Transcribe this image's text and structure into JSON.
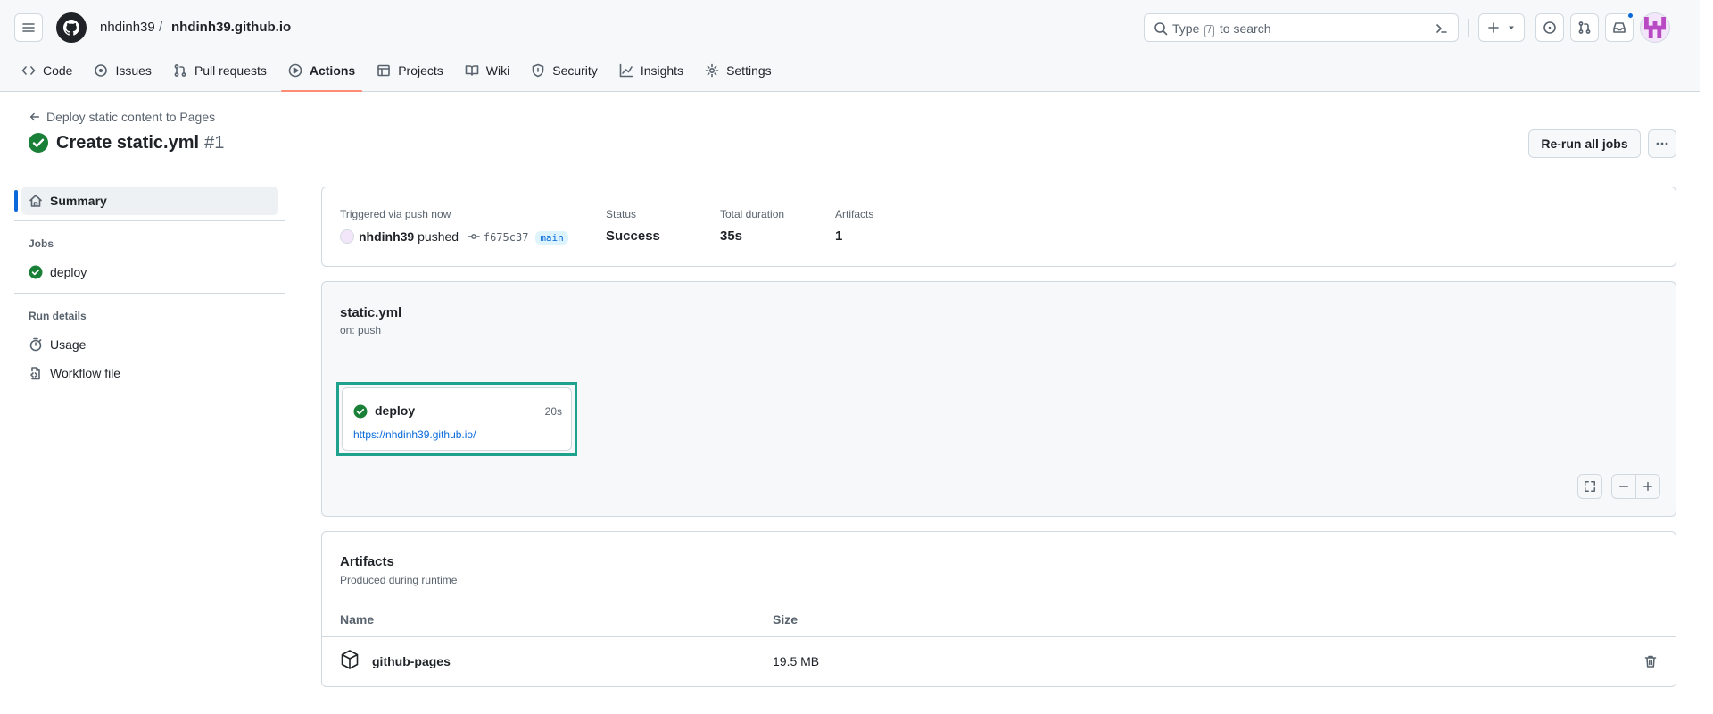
{
  "header": {
    "owner": "nhdinh39",
    "separator": "/",
    "repo": "nhdinh39.github.io",
    "search": {
      "pre": "Type",
      "key": "/",
      "post": "to search"
    }
  },
  "nav": {
    "tabs": [
      {
        "label": "Code",
        "icon": "code-icon"
      },
      {
        "label": "Issues",
        "icon": "issue-icon"
      },
      {
        "label": "Pull requests",
        "icon": "pull-request-icon"
      },
      {
        "label": "Actions",
        "icon": "play-icon",
        "active": true
      },
      {
        "label": "Projects",
        "icon": "table-icon"
      },
      {
        "label": "Wiki",
        "icon": "book-icon"
      },
      {
        "label": "Security",
        "icon": "shield-icon"
      },
      {
        "label": "Insights",
        "icon": "graph-icon"
      },
      {
        "label": "Settings",
        "icon": "gear-icon"
      }
    ]
  },
  "run": {
    "back_label": "Deploy static content to Pages",
    "title": "Create static.yml",
    "number": "#1",
    "rerun_label": "Re-run all jobs"
  },
  "sidebar": {
    "summary": "Summary",
    "jobs_heading": "Jobs",
    "job": "deploy",
    "run_details_heading": "Run details",
    "usage": "Usage",
    "workflow_file": "Workflow file"
  },
  "summary": {
    "trigger_label": "Triggered via push now",
    "actor": "nhdinh39",
    "action": "pushed",
    "commit": "f675c37",
    "branch": "main",
    "status_label": "Status",
    "status_value": "Success",
    "duration_label": "Total duration",
    "duration_value": "35s",
    "artifacts_label": "Artifacts",
    "artifacts_value": "1"
  },
  "graph": {
    "workflow": "static.yml",
    "on": "on: push",
    "job": {
      "name": "deploy",
      "time": "20s",
      "url": "https://nhdinh39.github.io/"
    }
  },
  "artifacts": {
    "title": "Artifacts",
    "subtitle": "Produced during runtime",
    "col_name": "Name",
    "col_size": "Size",
    "rows": [
      {
        "name": "github-pages",
        "size": "19.5 MB"
      }
    ]
  },
  "colors": {
    "success": "#1a7f37",
    "link": "#0969da",
    "active_tab": "#fd8c73",
    "focus_ring": "#1ea28e"
  }
}
